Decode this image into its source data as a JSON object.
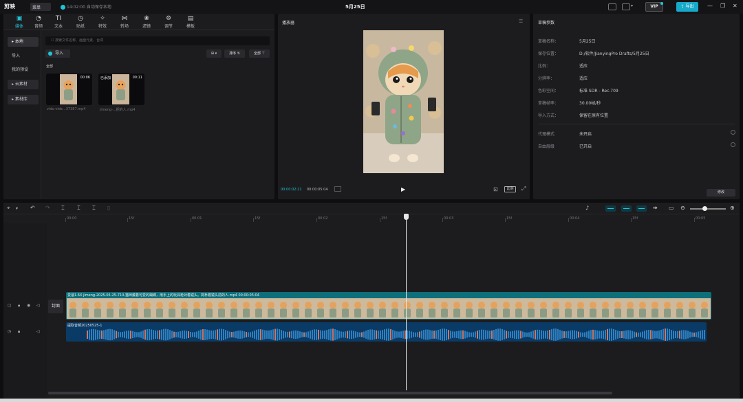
{
  "titlebar": {
    "logo": "剪映",
    "menu": "菜单",
    "save_status": "14:02:00 自动保存本地",
    "project_title": "5月25日",
    "vip": "VIP",
    "export": "导出",
    "window_controls": [
      "—",
      "❐",
      "✕"
    ]
  },
  "tool_tabs": [
    {
      "label": "媒体",
      "icon": "media-icon",
      "glyph": "▣",
      "active": true
    },
    {
      "label": "音频",
      "icon": "audio-icon",
      "glyph": "◔"
    },
    {
      "label": "文本",
      "icon": "text-icon",
      "glyph": "TI"
    },
    {
      "label": "贴纸",
      "icon": "sticker-icon",
      "glyph": "◷"
    },
    {
      "label": "特效",
      "icon": "effects-icon",
      "glyph": "✧"
    },
    {
      "label": "转场",
      "icon": "transition-icon",
      "glyph": "⋈"
    },
    {
      "label": "滤镜",
      "icon": "filter-icon",
      "glyph": "❀"
    },
    {
      "label": "调节",
      "icon": "adjust-icon",
      "glyph": "⚙"
    },
    {
      "label": "模板",
      "icon": "template-icon",
      "glyph": "▤"
    }
  ],
  "side_nav": [
    {
      "label": "▸ 本地",
      "active": true
    },
    {
      "label": "导入"
    },
    {
      "label": "我的预设"
    },
    {
      "label": "▸ 云素材"
    },
    {
      "label": "▸ 素材库"
    }
  ],
  "media": {
    "search_placeholder": "搜索文件名称、画面元素、台词",
    "import_label": "导入",
    "sort_label": "排序 ⇅",
    "filter_label": "全部 ⊤",
    "section_label": "全部",
    "items": [
      {
        "name": "vidu-vide...37387.mp4",
        "duration": "00:06",
        "added": ""
      },
      {
        "name": "jimeng-...把的人.mp4",
        "duration": "00:11",
        "added": "已添加"
      }
    ]
  },
  "player": {
    "title": "播放器",
    "current_time": "00:00:02:21",
    "total_time": "00:00:05:04",
    "ratio": "比例"
  },
  "props": {
    "title": "草稿参数",
    "rows": [
      {
        "label": "草稿名称：",
        "value": "5月25日"
      },
      {
        "label": "保存位置：",
        "value": "D:/软件/JianyingPro Drafts/5月25日"
      },
      {
        "label": "比例：",
        "value": "适应"
      },
      {
        "label": "分辨率：",
        "value": "适应"
      },
      {
        "label": "色彩空间：",
        "value": "标准 SDR - Rec.709"
      },
      {
        "label": "草稿帧率：",
        "value": "30.00帧/秒"
      },
      {
        "label": "导入方式：",
        "value": "保留在原有位置"
      },
      {
        "label": "代理模式",
        "value": "未开启"
      },
      {
        "label": "自由层级",
        "value": "已开启"
      }
    ],
    "modify": "修改"
  },
  "timeline": {
    "ticks": [
      "00:00",
      "15f",
      "00:01",
      "15f",
      "00:02",
      "15f",
      "00:03",
      "15f",
      "00:04",
      "15f",
      "00:05"
    ],
    "cover_label": "封面",
    "video_clip_label": "变速1.6X  jimeng-2025-05-25-710-猫咪戴着可爱的蝴蝶，用手上的玩具枪对着镜头。简朴着镜头前的人.mp4  00:00:05:04",
    "audio_clip_label": "提取音频20250525-1",
    "playhead_time_fraction": 0.49
  }
}
